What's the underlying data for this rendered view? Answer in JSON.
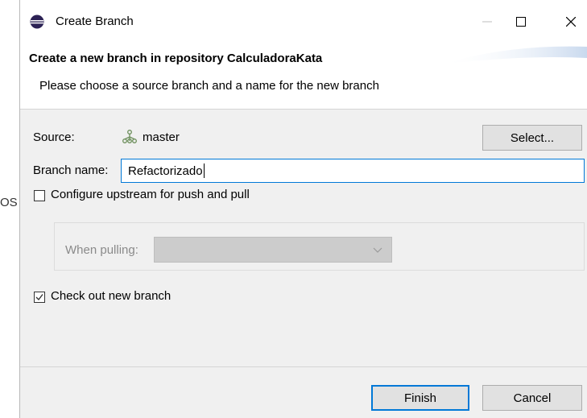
{
  "background": {
    "partial_text": "OS"
  },
  "window": {
    "title": "Create Branch",
    "app_icon": "eclipse-icon",
    "controls": {
      "minimize_icon": "minimize-icon",
      "maximize_icon": "maximize-icon",
      "close_icon": "close-icon"
    }
  },
  "banner": {
    "title": "Create a new branch in repository CalculadoraKata",
    "message": "Please choose a source branch and a name for the new branch"
  },
  "form": {
    "source_label": "Source:",
    "source_icon": "branch-icon",
    "source_value": "master",
    "select_button": "Select...",
    "branch_name_label": "Branch name:",
    "branch_name_value": "Refactorizado",
    "configure_upstream": {
      "label": "Configure upstream for push and pull",
      "checked": false
    },
    "when_pulling": {
      "label": "When pulling:",
      "value": "",
      "enabled": false
    },
    "checkout": {
      "label": "Check out new branch",
      "checked": true
    }
  },
  "footer": {
    "finish_button": "Finish",
    "cancel_button": "Cancel"
  },
  "colors": {
    "focus_border": "#0078d7",
    "dialog_bg": "#f0f0f0",
    "button_bg": "#e1e1e1",
    "disabled_select": "#cccccc"
  }
}
